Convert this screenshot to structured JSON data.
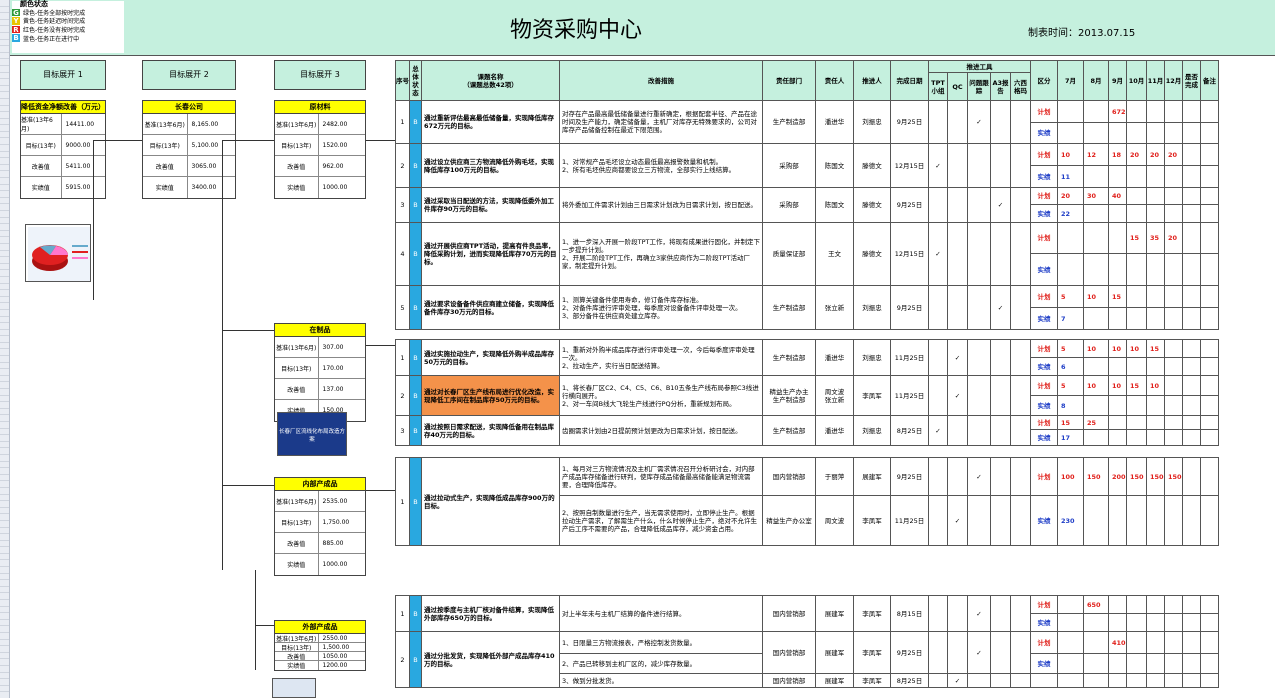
{
  "legend": {
    "title": "颜色状态",
    "items": [
      {
        "code": "G",
        "color": "#2e9a3c",
        "text": "绿色-任务全部按时完成"
      },
      {
        "code": "Y",
        "color": "#e8c500",
        "text": "黄色-任务延迟时间完成"
      },
      {
        "code": "R",
        "color": "#e0201b",
        "text": "红色-任务没有按时完成"
      },
      {
        "code": "B",
        "color": "#29a8e0",
        "text": "蓝色-任务正在进行中"
      }
    ]
  },
  "title": "物资采购中心",
  "date": "制表时间：2013.07.15",
  "col_headers": [
    "目标展开 1",
    "目标展开 2",
    "目标展开 3"
  ],
  "targets": {
    "t1": {
      "title": "降低资金净额改善（万元）",
      "rows": [
        [
          "基准(13年6月)",
          "14411.00"
        ],
        [
          "目标(13年)",
          "9000.00"
        ],
        [
          "改善值",
          "5411.00"
        ],
        [
          "实绩值",
          "5915.00"
        ]
      ]
    },
    "t2": {
      "title": "长春公司",
      "rows": [
        [
          "基准(13年6月)",
          "8,165.00"
        ],
        [
          "目标(13年)",
          "5,100.00"
        ],
        [
          "改善值",
          "3065.00"
        ],
        [
          "实绩值",
          "3400.00"
        ]
      ]
    },
    "t3a": {
      "title": "原材料",
      "rows": [
        [
          "基准(13年6月)",
          "2482.00"
        ],
        [
          "目标(13年)",
          "1520.00"
        ],
        [
          "改善值",
          "962.00"
        ],
        [
          "实绩值",
          "1000.00"
        ]
      ]
    },
    "t3b": {
      "title": "在制品",
      "rows": [
        [
          "基准(13年6月)",
          "307.00"
        ],
        [
          "目标(13年)",
          "170.00"
        ],
        [
          "改善值",
          "137.00"
        ],
        [
          "实绩值",
          "150.00"
        ]
      ]
    },
    "t3c": {
      "title": "内部产成品",
      "rows": [
        [
          "基准(13年6月)",
          "2535.00"
        ],
        [
          "目标(13年)",
          "1,750.00"
        ],
        [
          "改善值",
          "885.00"
        ],
        [
          "实绩值",
          "1000.00"
        ]
      ]
    },
    "t3d": {
      "title": "外部产成品",
      "rows": [
        [
          "基准(13年6月)",
          "2550.00"
        ],
        [
          "目标(13年)",
          "1,500.00"
        ],
        [
          "改善值",
          "1050.00"
        ],
        [
          "实绩值",
          "1200.00"
        ]
      ]
    }
  },
  "thumb_caption": "长春厂区流线化布局改造方案",
  "table": {
    "headers": {
      "seq": "序号",
      "status": "总体状态",
      "task": "课题名称\n（课题总数42项）",
      "measure": "改善措施",
      "dept": "责任部门",
      "owner": "责任人",
      "pusher": "推进人",
      "due": "完成日期",
      "tools": "推进工具",
      "tool_cols": [
        "TPT小组",
        "QC",
        "问题跟踪",
        "A3报告",
        "六西格玛"
      ],
      "kind": "区分",
      "months": [
        "7月",
        "8月",
        "9月",
        "10月",
        "11月",
        "12月"
      ],
      "done": "是否完成",
      "note": "备注"
    },
    "plan_label": "计划",
    "actual_label": "实绩",
    "groups": [
      {
        "rows": [
          {
            "seq": "1",
            "status": "B",
            "task": "通过重新评估最高最低储备量，实现降低库存672万元的目标。",
            "measure": "对存在产品最高最低储备量进行重新确定，根据配套半径、产品在途时间及生产能力，确定储备量，主机厂对库存无特殊要求的，公司对库存产品储备控制在最近下限范围。",
            "dept": "生产制造部",
            "owner": "潘进华",
            "pusher": "刘振忠",
            "due": "9月25日",
            "tools": [
              "",
              "",
              "✓",
              "",
              ""
            ],
            "plan": [
              "",
              "",
              "672",
              "",
              "",
              ""
            ],
            "actual": [
              "",
              "",
              "",
              "",
              "",
              ""
            ]
          },
          {
            "seq": "2",
            "status": "B",
            "task": "通过设立供应商三方物流降低外购毛坯，实现降低库存100万元的目标。",
            "measure": "1、对常规产品毛坯设立动态最低最高报警数量和机制。\n2、所有毛坯供应商都要设立三方物流，全部实行上线结算。",
            "dept": "采购部",
            "owner": "陈国文",
            "pusher": "滕德文",
            "due": "12月15日",
            "tools": [
              "✓",
              "",
              "",
              "",
              ""
            ],
            "plan": [
              "10",
              "12",
              "18",
              "20",
              "20",
              "20"
            ],
            "actual": [
              "11",
              "",
              "",
              "",
              "",
              ""
            ]
          },
          {
            "seq": "3",
            "status": "B",
            "task": "通过采取当日配送的方法，实现降低委外加工件库存90万元的目标。",
            "measure": "将外委加工件需求计划由三日需求计划改为日需求计划，按日配送。",
            "dept": "采购部",
            "owner": "陈国文",
            "pusher": "滕德文",
            "due": "9月25日",
            "tools": [
              "",
              "",
              "",
              "✓",
              ""
            ],
            "plan": [
              "20",
              "30",
              "40",
              "",
              "",
              ""
            ],
            "actual": [
              "22",
              "",
              "",
              "",
              "",
              ""
            ]
          },
          {
            "seq": "4",
            "status": "B",
            "task": "通过开展供应商TPT活动，提高有件良品率，降低采购计划，进而实现降低库存70万元的目标。",
            "measure": "1、进一步深入开展一阶段TPT工作，将现有成果进行固化，并制定下一步提升计划。\n2、开展二阶段TPT工作，再确立3家供应商作为二阶段TPT活动厂家，制定提升计划。",
            "dept": "质量保证部",
            "owner": "王文",
            "pusher": "滕德文",
            "due": "12月15日",
            "tools": [
              "✓",
              "",
              "",
              "",
              ""
            ],
            "plan": [
              "",
              "",
              "",
              "15",
              "35",
              "20"
            ],
            "actual": [
              "",
              "",
              "",
              "",
              "",
              ""
            ]
          },
          {
            "seq": "5",
            "status": "B",
            "task": "通过要求设备备件供应商建立储备，实现降低备件库存30万元的目标。",
            "measure": "1、测算关键备件使用寿命，修订备件库存标准。\n2、对备件库进行评审处理，每季度对设备备件评审处理一次。\n3、部分备件在供应商处建立库存。",
            "dept": "生产制造部",
            "owner": "张立新",
            "pusher": "刘振忠",
            "due": "9月25日",
            "tools": [
              "",
              "",
              "",
              "✓",
              ""
            ],
            "plan": [
              "5",
              "10",
              "15",
              "",
              "",
              ""
            ],
            "actual": [
              "7",
              "",
              "",
              "",
              "",
              ""
            ]
          }
        ]
      },
      {
        "rows": [
          {
            "seq": "1",
            "status": "B",
            "task": "通过实施拉动生产，实现降低外购半成品库存50万元的目标。",
            "measure": "1、重新对外购半成品库存进行评审处理一次，今后每季度评审处理一次。\n2、拉动生产，实行当日配送结算。",
            "dept": "生产制造部",
            "owner": "潘进华",
            "pusher": "刘振忠",
            "due": "11月25日",
            "tools": [
              "",
              "✓",
              "",
              "",
              ""
            ],
            "plan": [
              "5",
              "10",
              "10",
              "10",
              "15",
              ""
            ],
            "actual": [
              "6",
              "",
              "",
              "",
              "",
              ""
            ]
          },
          {
            "seq": "2",
            "status": "B",
            "task": "通过对长春厂区生产线布局进行优化改造，实现降低工序间在制品库存50万元的目标。",
            "measure": "1、将长春厂区C2、C4、C5、C6、B10五条生产线布局参照C3线进行横向展开。\n2、对一车间B线大飞轮生产线进行PQ分析，重新规划布局。",
            "dept": "精益生产办主\n生产制造部",
            "owner": "周文波\n张立新",
            "pusher": "李凤军",
            "due": "11月25日",
            "tools": [
              "",
              "✓",
              "",
              "",
              ""
            ],
            "plan": [
              "5",
              "10",
              "10",
              "15",
              "10",
              ""
            ],
            "actual": [
              "8",
              "",
              "",
              "",
              "",
              ""
            ]
          },
          {
            "seq": "3",
            "status": "B",
            "task": "通过按照日需求配送，实现降低备用在制品库存40万元的目标。",
            "measure": "齿圈需求计划由2日提前预计划更改为日需求计划，按日配送。",
            "dept": "生产制造部",
            "owner": "潘进华",
            "pusher": "刘振忠",
            "due": "8月25日",
            "tools": [
              "✓",
              "",
              "",
              "",
              ""
            ],
            "plan": [
              "15",
              "25",
              "",
              "",
              "",
              ""
            ],
            "actual": [
              "17",
              "",
              "",
              "",
              "",
              ""
            ]
          }
        ]
      },
      {
        "rows": [
          {
            "seq": "1",
            "status": "B",
            "task": "通过拉动式生产，实现降低成品库存900万的目标。",
            "measure": "1、每月对三方物流情况及主机厂需求情况召开分析研讨会，对内部产成品库存储备进行研判，使库存成品储备最高储备能满足物流需要，合理降低库存。",
            "dept": "国内营销部",
            "owner": "于丽萍",
            "pusher": "展建军",
            "due": "9月25日",
            "tools": [
              "",
              "",
              "✓",
              "",
              ""
            ],
            "plan": [
              "100",
              "150",
              "200",
              "150",
              "150",
              "150"
            ],
            "measure2": "2、按照自制数量进行生产，当无需求使用时，立即停止生产。根据拉动生产需求，了解需生产什么，什么时候停止生产，绝对不允许生产后工序不需要的产品，合理降低成品库存，减少资金占用。",
            "dept2": "精益生产办公室",
            "owner2": "周文波",
            "pusher2": "李凤军",
            "due2": "11月25日",
            "tools2": [
              "",
              "✓",
              "",
              "",
              ""
            ],
            "actual": [
              "230",
              "",
              "",
              "",
              "",
              ""
            ]
          }
        ]
      },
      {
        "rows": [
          {
            "seq": "1",
            "status": "B",
            "task": "通过按季度与主机厂核对备件结算，实现降低外部库存650万的目标。",
            "measure": "对上半年未与主机厂结算的备件进行结算。",
            "dept": "国内营销部",
            "owner": "展建军",
            "pusher": "李凤军",
            "due": "8月15日",
            "tools": [
              "",
              "",
              "✓",
              "",
              ""
            ],
            "plan": [
              "",
              "650",
              "",
              "",
              "",
              ""
            ],
            "actual": [
              "",
              "",
              "",
              "",
              "",
              ""
            ]
          },
          {
            "seq": "2",
            "status": "B",
            "task": "通过分批发货，实现降低外部产成品库存410万的目标。",
            "measure": "1、日限量三方物流报表，严格控制发货数量。",
            "dept": "国内营销部",
            "owner": "展建军",
            "pusher": "李凤军",
            "due": "9月25日",
            "tools": [
              "",
              "",
              "✓",
              "",
              ""
            ],
            "plan": [
              "",
              "",
              "410",
              "",
              "",
              ""
            ],
            "measure2": "2、产品已转移到主机厂区的，减少库存数量。",
            "measure3": "3、做到分批发货。",
            "dept3": "国内营销部",
            "owner3": "展建军",
            "pusher3": "李凤军",
            "due3": "8月25日",
            "tools3": [
              "",
              "✓",
              "",
              "",
              ""
            ],
            "actual": [
              "",
              "",
              "",
              "",
              "",
              ""
            ]
          }
        ]
      }
    ]
  }
}
